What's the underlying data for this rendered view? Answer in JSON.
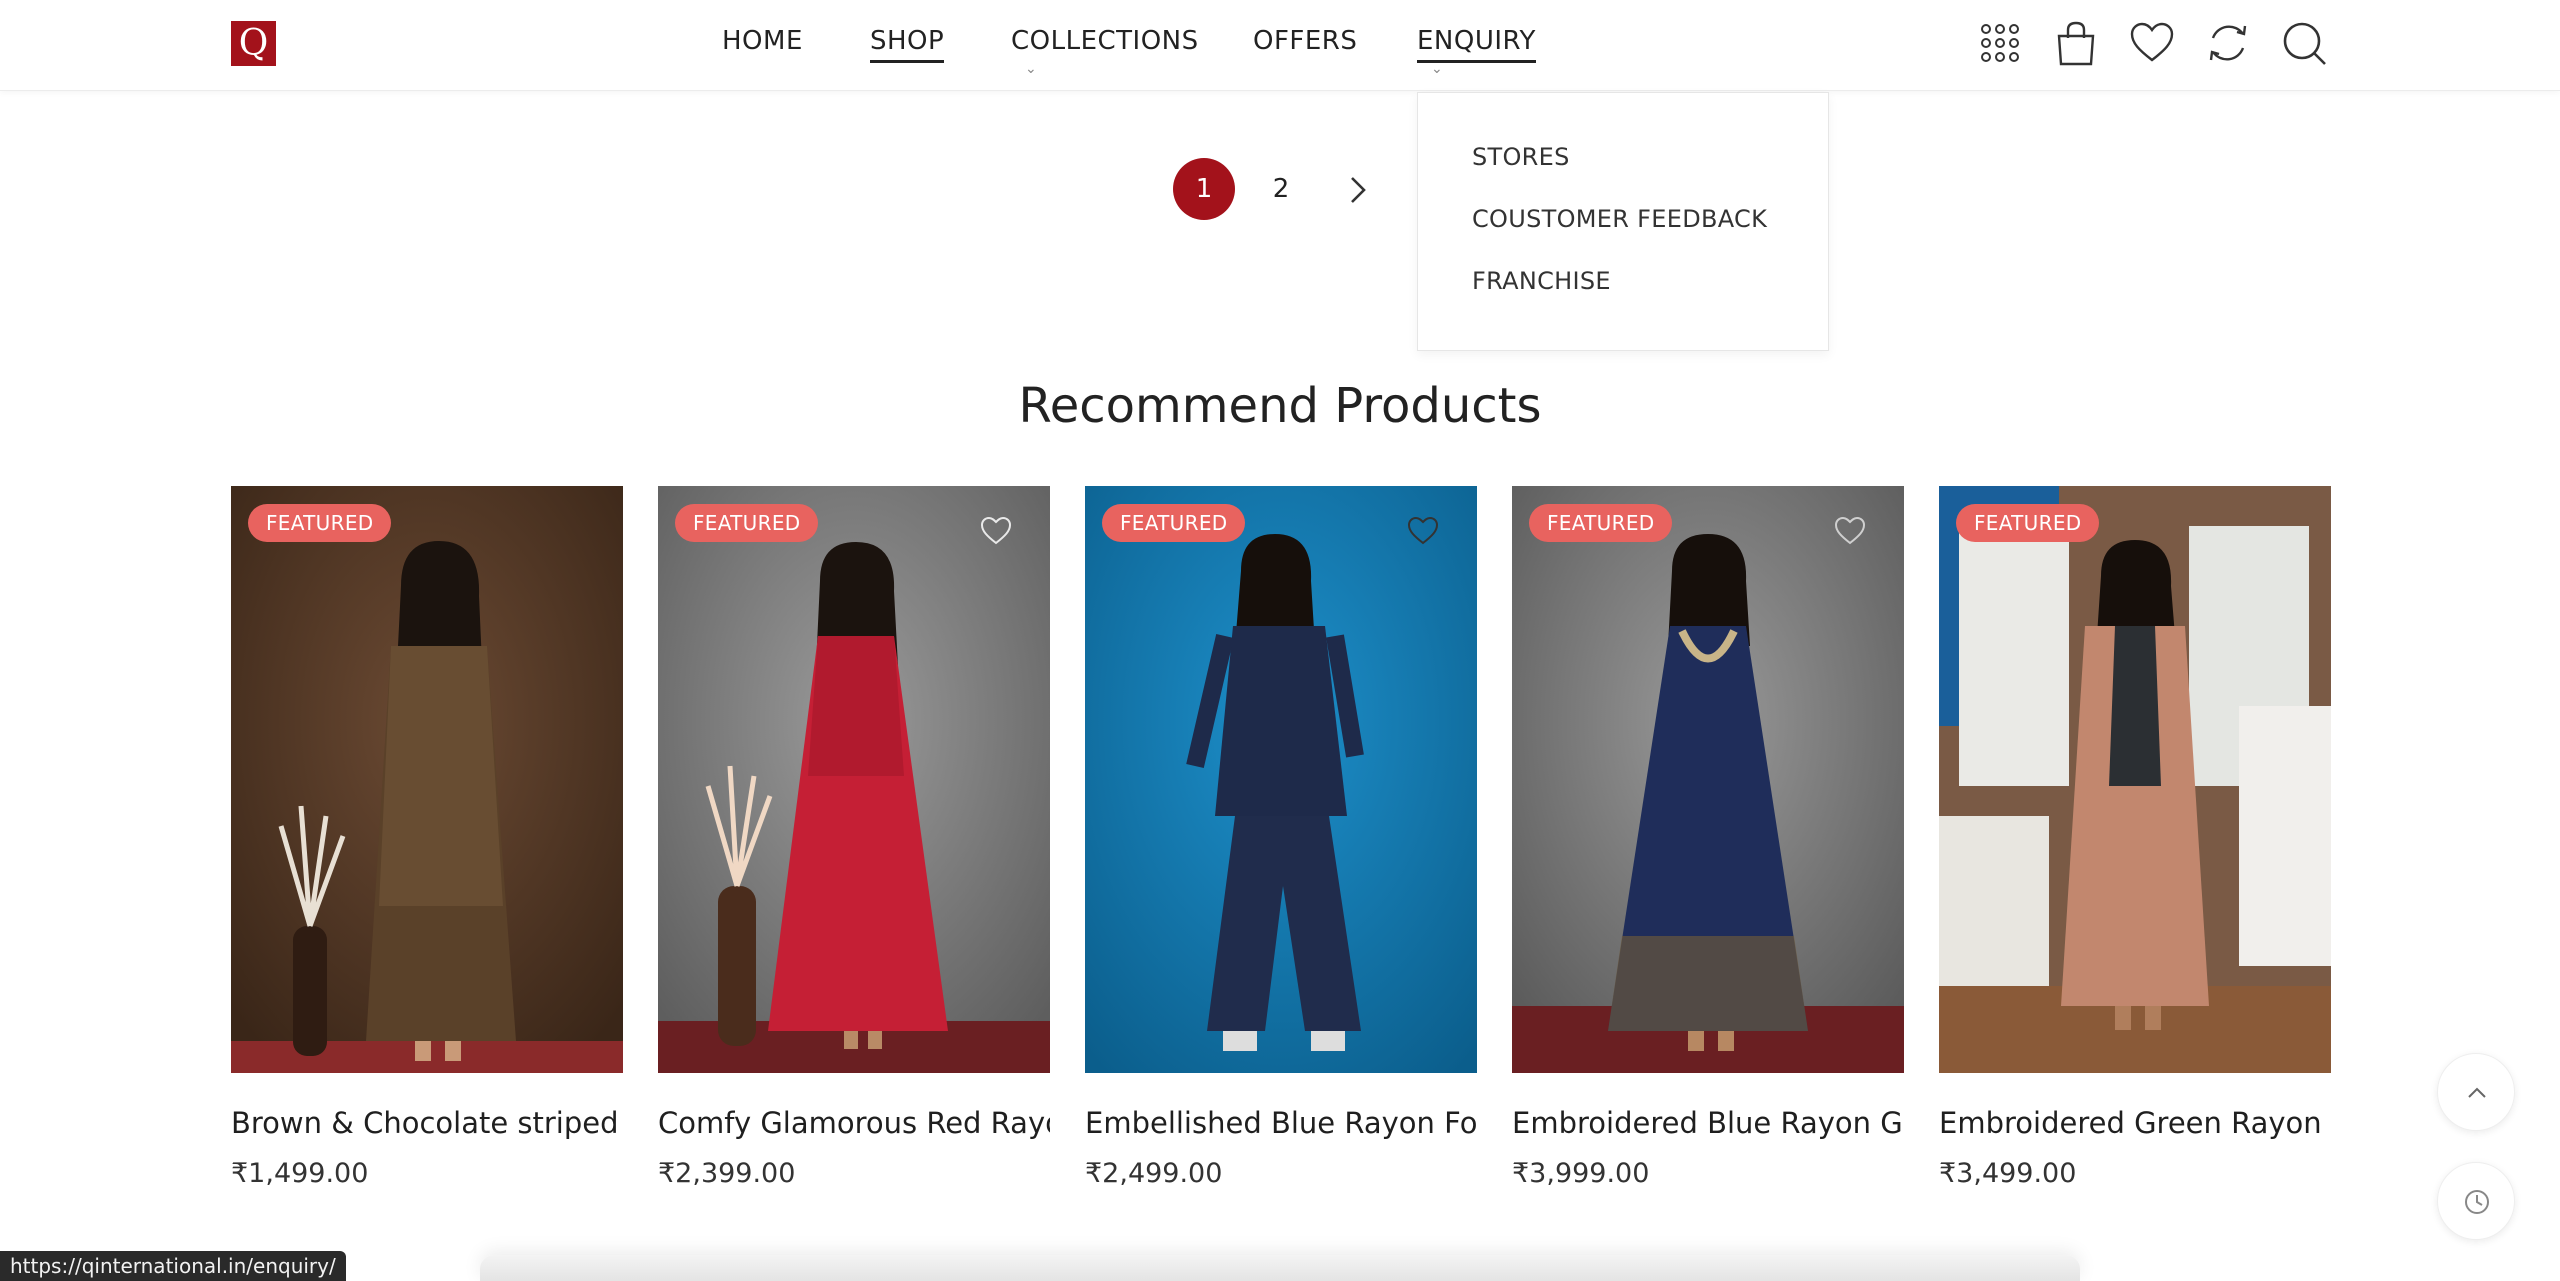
{
  "brand": {
    "logo_letter": "Q",
    "color": "#a3121b"
  },
  "nav": {
    "items": [
      {
        "label": "HOME"
      },
      {
        "label": "SHOP"
      },
      {
        "label": "COLLECTIONS"
      },
      {
        "label": "OFFERS"
      },
      {
        "label": "ENQUIRY"
      }
    ],
    "active": [
      "SHOP",
      "ENQUIRY"
    ],
    "dropdown_items": [
      "STORES",
      "COUSTOMER FEEDBACK",
      "FRANCHISE"
    ]
  },
  "header_icons": [
    "grid-icon",
    "shopping-bag-icon",
    "heart-icon",
    "compare-icon",
    "search-icon"
  ],
  "pagination": {
    "pages": [
      "1",
      "2"
    ],
    "current": "1"
  },
  "section": {
    "title": "Recommend Products"
  },
  "products": [
    {
      "badge": "FEATURED",
      "name": "Brown & Chocolate striped ...",
      "price": "₹1,499.00"
    },
    {
      "badge": "FEATURED",
      "name": "Comfy Glamorous Red Rayo...",
      "price": "₹2,399.00"
    },
    {
      "badge": "FEATURED",
      "name": "Embellished Blue Rayon Foil ...",
      "price": "₹2,499.00"
    },
    {
      "badge": "FEATURED",
      "name": "Embroidered Blue Rayon Go...",
      "price": "₹3,999.00"
    },
    {
      "badge": "FEATURED",
      "name": "Embroidered Green Rayon L...",
      "price": "₹3,499.00"
    }
  ],
  "status_url": "https://qinternational.in/enquiry/",
  "colors": {
    "accent": "#a3121b",
    "badge": "#e8635f"
  }
}
